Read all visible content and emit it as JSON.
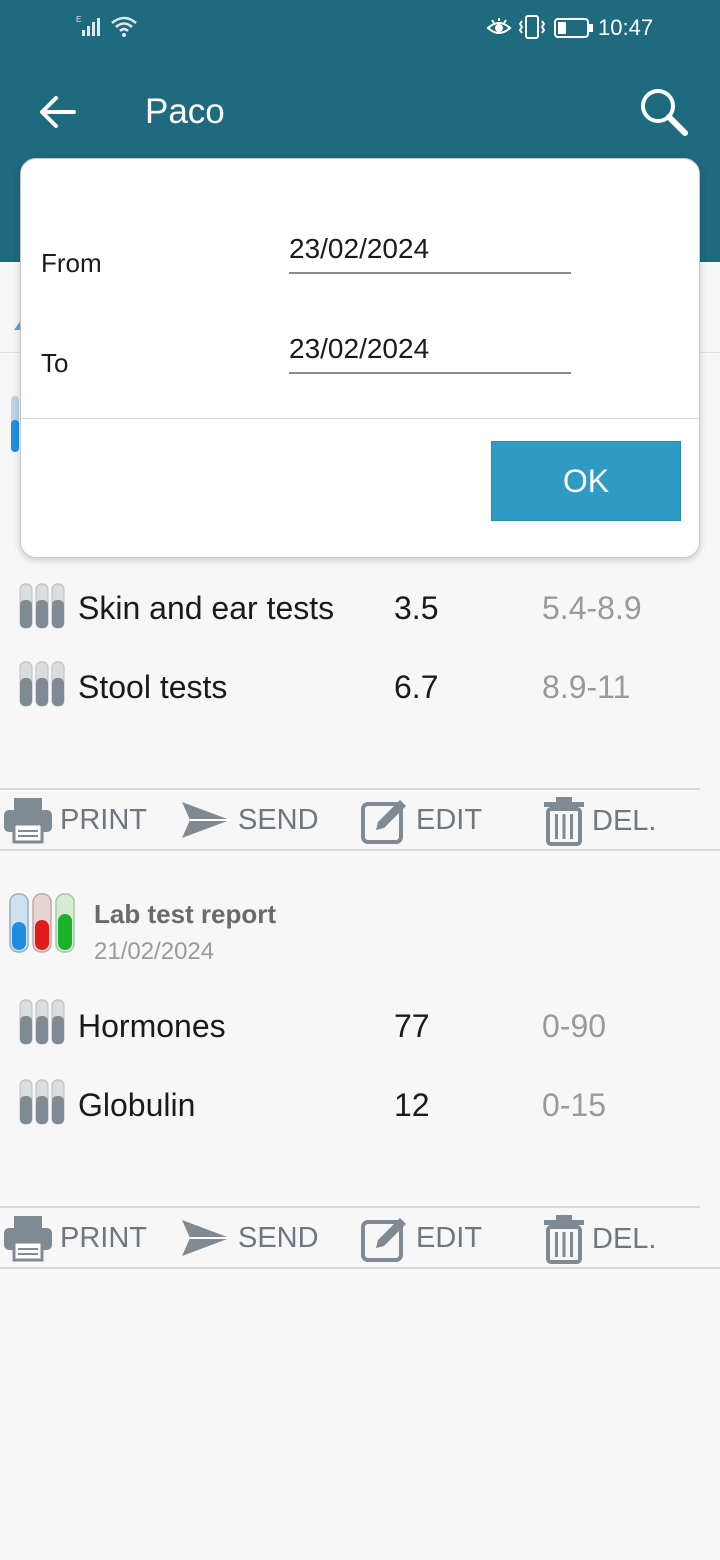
{
  "status_bar": {
    "time": "10:47",
    "signal_icon": "cell-signal-icon",
    "wifi_icon": "wifi-icon",
    "eye_icon": "eye-comfort-icon",
    "vibrate_icon": "vibrate-icon",
    "battery_icon": "battery-icon"
  },
  "header": {
    "title": "Paco",
    "back_icon": "arrow-left-icon",
    "search_icon": "search-icon"
  },
  "dialog": {
    "from_label": "From",
    "from_value": "23/02/2024",
    "to_label": "To",
    "to_value": "23/02/2024",
    "ok_label": "OK"
  },
  "report1": {
    "rows": [
      {
        "name": "Skin and ear tests",
        "value": "3.5",
        "range": "5.4-8.9"
      },
      {
        "name": "Stool tests",
        "value": "6.7",
        "range": "8.9-11"
      }
    ]
  },
  "report2": {
    "title": "Lab test report",
    "date": "21/02/2024",
    "rows": [
      {
        "name": "Hormones",
        "value": "77",
        "range": "0-90"
      },
      {
        "name": "Globulin",
        "value": "12",
        "range": "0-15"
      }
    ]
  },
  "actions": {
    "print": "PRINT",
    "send": "SEND",
    "edit": "EDIT",
    "delete": "DEL."
  },
  "colors": {
    "header": "#1e6a7e",
    "ok_button": "#2f9ac3",
    "blue_tube": "#1e8fe0",
    "red_tube": "#e01b1b",
    "green_tube": "#19b32a"
  }
}
